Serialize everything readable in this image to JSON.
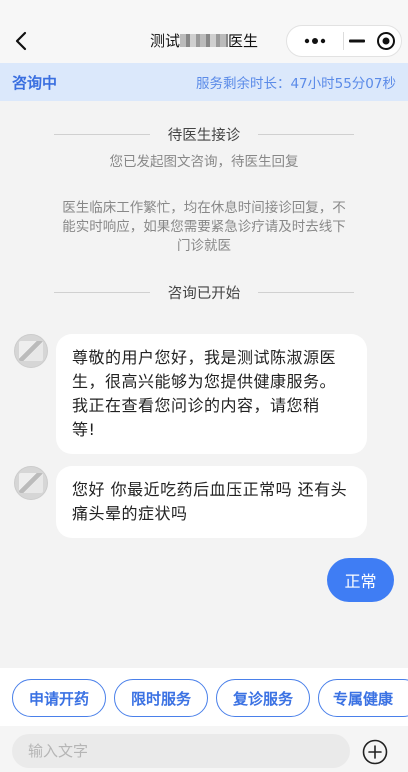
{
  "nav": {
    "title_prefix": "测试",
    "title_suffix": "医生"
  },
  "status": {
    "label": "咨询中",
    "remaining": "服务剩余时长：47小时55分07秒"
  },
  "system": {
    "waiting_title": "待医生接诊",
    "waiting_sub": "您已发起图文咨询，待医生回复",
    "busy_line1": "医生临床工作繁忙，均在休息时间接诊回复，不",
    "busy_line2": "能实时响应，如果您需要紧急诊疗请及时去线下",
    "busy_line3": "门诊就医",
    "started": "咨询已开始"
  },
  "messages": [
    {
      "from": "doctor",
      "lines": [
        "尊敬的用户您好，我是测试陈淑源医",
        "生，很高兴能够为您提供健康服务。",
        "我正在查看您问诊的内容，请您稍",
        "等!"
      ]
    },
    {
      "from": "doctor",
      "lines": [
        "您好 你最近吃药后血压正常吗 还有头",
        "痛头晕的症状吗"
      ]
    },
    {
      "from": "user",
      "text": "正常"
    }
  ],
  "quick_actions": [
    "申请开药",
    "限时服务",
    "复诊服务",
    "专属健康"
  ],
  "input": {
    "placeholder": "输入文字"
  },
  "colors": {
    "accent": "#3f7df4",
    "status_bg": "#dbe8fb"
  }
}
